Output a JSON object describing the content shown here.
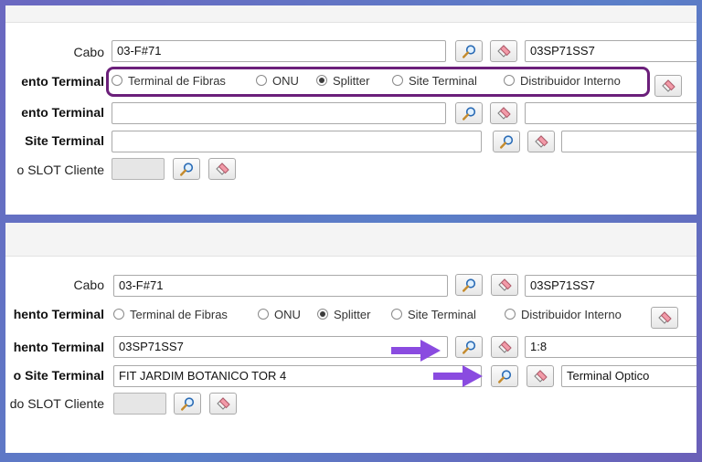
{
  "labels": {
    "cabo": "Cabo",
    "equipamento_terminal_tipo": "ento Terminal",
    "equipamento_terminal": "ento Terminal",
    "site_terminal": "Site Terminal",
    "slot_cliente": "o SLOT Cliente"
  },
  "labels_bottom": {
    "cabo": "Cabo",
    "equipamento_terminal_tipo": "hento Terminal",
    "equipamento_terminal": "hento Terminal",
    "site_terminal": "o Site Terminal",
    "slot_cliente": "do SLOT Cliente"
  },
  "terminal_types": [
    "Terminal de Fibras",
    "ONU",
    "Splitter",
    "Site Terminal",
    "Distribuidor Interno"
  ],
  "selected_terminal_type": "Splitter",
  "before": {
    "cabo": "03-F#71",
    "cabo_code": "03SP71SS7",
    "equipamento": "",
    "equipamento_extra": "",
    "site": "",
    "site_extra": "",
    "slot": ""
  },
  "after": {
    "cabo": "03-F#71",
    "cabo_code": "03SP71SS7",
    "equipamento": "03SP71SS7",
    "equipamento_extra": "1:8",
    "site": "FIT JARDIM BOTANICO TOR 4",
    "site_extra": "Terminal Optico",
    "slot": ""
  },
  "colors": {
    "highlight_border": "#6b1f7a",
    "arrow": "#8a4be0",
    "background": "#6a67c0"
  },
  "icons": {
    "search": "magnifier-icon",
    "clear": "eraser-icon"
  }
}
